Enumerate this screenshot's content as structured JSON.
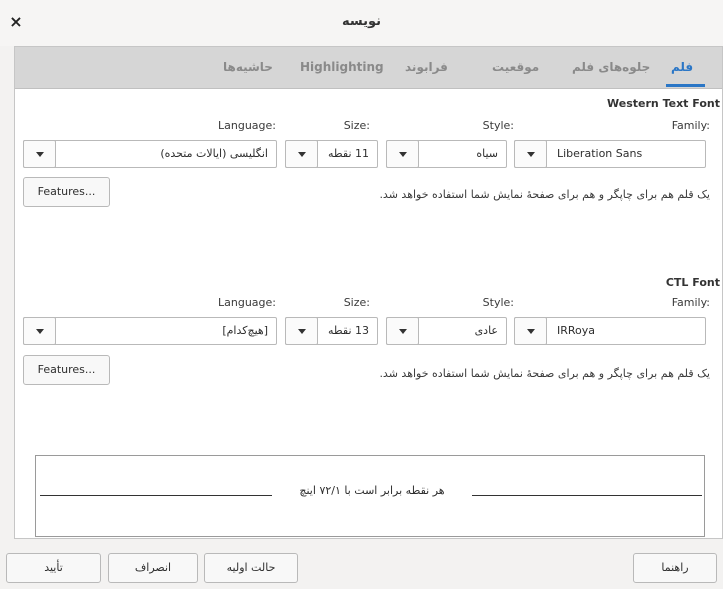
{
  "window": {
    "title": "نویسه",
    "close_glyph": "×"
  },
  "tabs": [
    {
      "label": "فلم",
      "active": true
    },
    {
      "label": "جلوه‌های فلم",
      "active": false
    },
    {
      "label": "موقعیت",
      "active": false
    },
    {
      "label": "فرابوند",
      "active": false
    },
    {
      "label": "Highlighting",
      "active": false
    },
    {
      "label": "حاشیه‌ها",
      "active": false
    }
  ],
  "western": {
    "heading": "Western Text Font",
    "family_label": "Family:",
    "family_value": "Liberation Sans",
    "style_label": "Style:",
    "style_value": "سیاه",
    "size_label": "Size:",
    "size_value": "11 نقطه",
    "language_label": "Language:",
    "language_value": "انگلیسی (ایالات متحده)",
    "features_label": "Features...",
    "hint": "یک قلم هم برای چاپگر و هم برای صفحهٔ نمایش شما استفاده خواهد شد."
  },
  "ctl": {
    "heading": "CTL Font",
    "family_label": "Family:",
    "family_value": "IRRoya",
    "style_label": "Style:",
    "style_value": "عادی",
    "size_label": "Size:",
    "size_value": "13 نقطه",
    "language_label": "Language:",
    "language_value": "[هیچ‌کدام]",
    "features_label": "Features...",
    "hint": "یک قلم هم برای چاپگر و هم برای صفحهٔ نمایش شما استفاده خواهد شد."
  },
  "preview": {
    "text": "هر نقطه برابر است با ۷۲/۱ اینچ"
  },
  "footer": {
    "help": "راهنما",
    "reset": "حالت اولیه",
    "cancel": "انصراف",
    "ok": "تأیید"
  },
  "colors": {
    "accent": "#2a76c6",
    "tabbar_bg": "#d6d6d6",
    "window_bg": "#f3f2f1"
  }
}
